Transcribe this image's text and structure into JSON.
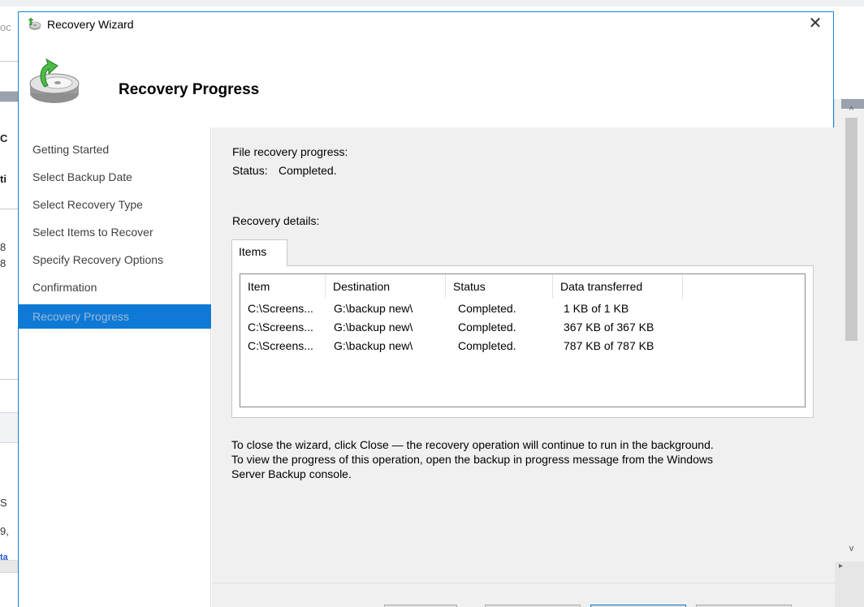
{
  "background": {
    "fragments": [
      "oc",
      "C",
      "ti",
      "8",
      "8",
      "S",
      "9,",
      "ta"
    ]
  },
  "window": {
    "title": "Recovery Wizard",
    "close_glyph": "✕"
  },
  "header": {
    "title": "Recovery Progress"
  },
  "nav": {
    "items": [
      {
        "label": "Getting Started"
      },
      {
        "label": "Select Backup Date"
      },
      {
        "label": "Select Recovery Type"
      },
      {
        "label": "Select Items to Recover"
      },
      {
        "label": "Specify Recovery Options"
      },
      {
        "label": "Confirmation"
      },
      {
        "label": "Recovery Progress"
      }
    ],
    "active_index": 6
  },
  "content": {
    "progress_label": "File recovery progress:",
    "status_label": "Status:",
    "status_value": "Completed.",
    "details_label": "Recovery details:",
    "tab_label": "Items",
    "table": {
      "headers": [
        "Item",
        "Destination",
        "Status",
        "Data transferred"
      ],
      "rows": [
        [
          "C:\\Screens...",
          "G:\\backup new\\",
          "Completed.",
          "1 KB of 1 KB"
        ],
        [
          "C:\\Screens...",
          "G:\\backup new\\",
          "Completed.",
          "367 KB of 367 KB"
        ],
        [
          "C:\\Screens...",
          "G:\\backup new\\",
          "Completed.",
          "787 KB of 787 KB"
        ]
      ]
    },
    "note_line1": "To close the wizard, click Close — the recovery operation will continue to run in the background.",
    "note_line2": "To view the progress of this operation, open the backup in progress message from the Windows",
    "note_line3": "Server Backup console."
  },
  "scrollbar": {
    "up_glyph": "^",
    "down_glyph": "v",
    "right_glyph": "▸"
  },
  "colors": {
    "accent": "#0e7ad6",
    "window_border": "#1883d7",
    "content_bg": "#f0f0f0"
  },
  "icons": {
    "app": "recovery-wizard-icon",
    "header": "disk-restore-icon",
    "close": "close-icon"
  }
}
